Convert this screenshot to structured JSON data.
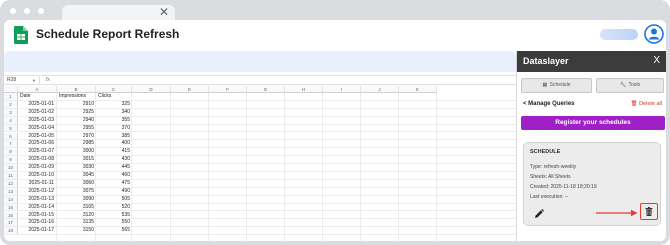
{
  "doc": {
    "title": "Schedule Report Refresh"
  },
  "formula": {
    "cell_ref": "R28",
    "fx": "fx"
  },
  "columns": [
    "A",
    "B",
    "C",
    "D",
    "E",
    "F",
    "G",
    "H",
    "I",
    "J",
    "K"
  ],
  "rows": [
    {
      "n": "1",
      "a": "Date",
      "b": "Impressions",
      "c": "Clicks"
    },
    {
      "n": "2",
      "a": "2025-01-01",
      "b": "2910",
      "c": "325"
    },
    {
      "n": "3",
      "a": "2025-01-02",
      "b": "2925",
      "c": "340"
    },
    {
      "n": "4",
      "a": "2025-01-03",
      "b": "2940",
      "c": "355"
    },
    {
      "n": "5",
      "a": "2025-01-04",
      "b": "2955",
      "c": "370"
    },
    {
      "n": "6",
      "a": "2025-01-05",
      "b": "2970",
      "c": "385"
    },
    {
      "n": "7",
      "a": "2025-01-06",
      "b": "2985",
      "c": "400"
    },
    {
      "n": "8",
      "a": "2025-01-07",
      "b": "3000",
      "c": "415"
    },
    {
      "n": "9",
      "a": "2025-01-08",
      "b": "3015",
      "c": "430"
    },
    {
      "n": "10",
      "a": "2025-01-09",
      "b": "3030",
      "c": "445"
    },
    {
      "n": "11",
      "a": "2025-01-10",
      "b": "3045",
      "c": "460"
    },
    {
      "n": "12",
      "a": "2025-01-11",
      "b": "3060",
      "c": "475"
    },
    {
      "n": "13",
      "a": "2025-01-12",
      "b": "3075",
      "c": "490"
    },
    {
      "n": "14",
      "a": "2025-01-13",
      "b": "3090",
      "c": "505"
    },
    {
      "n": "15",
      "a": "2025-01-14",
      "b": "3105",
      "c": "520"
    },
    {
      "n": "16",
      "a": "2025-01-15",
      "b": "3120",
      "c": "535"
    },
    {
      "n": "17",
      "a": "2025-01-16",
      "b": "3135",
      "c": "550"
    },
    {
      "n": "18",
      "a": "2025-01-17",
      "b": "3150",
      "c": "565"
    }
  ],
  "panel": {
    "title": "Dataslayer",
    "close": "X",
    "schedule_btn": "Schedule",
    "tools_btn": "Tools",
    "manage": "< Manage Queries",
    "delete_all": "Delete all",
    "register": "Register your schedules",
    "card": {
      "title": "SCHEDULE",
      "type": "Type: refresh-weekly",
      "sheets": "Sheets: All Sheets",
      "created": "Created: 2025-11-18 18:20:19",
      "last": "Last execution: --"
    }
  },
  "colors": {
    "accent": "#a020c8",
    "danger": "#e53935",
    "panel_header": "#3c3c3c"
  }
}
